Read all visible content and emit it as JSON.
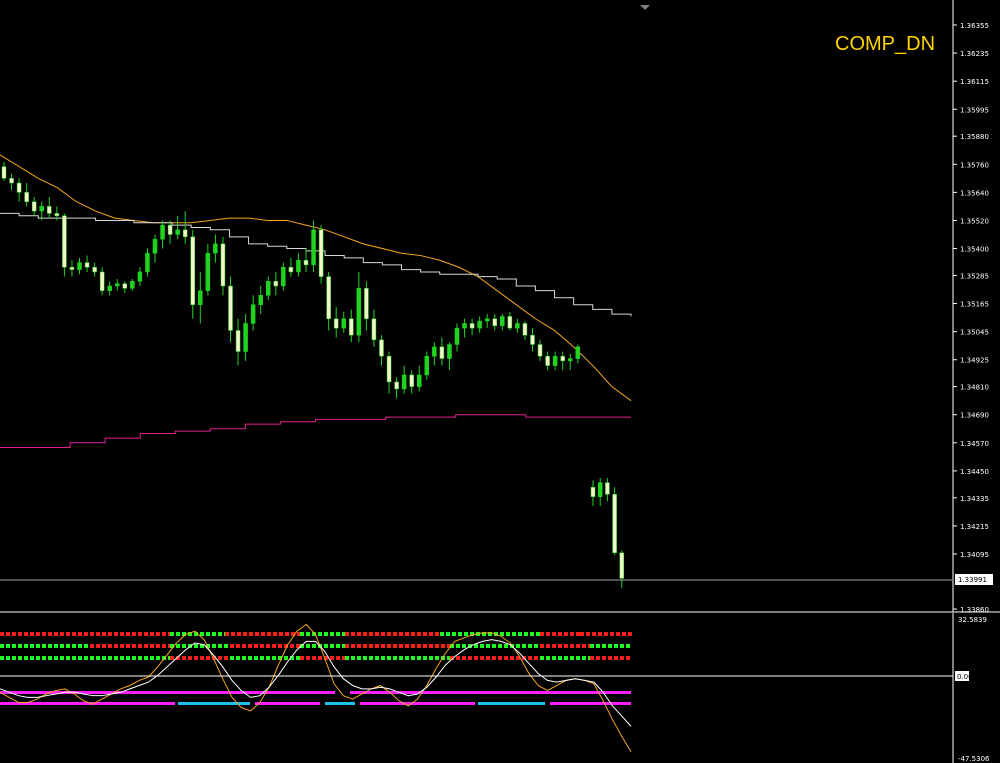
{
  "chart_title": "COMP_DN",
  "colors": {
    "background": "#000000",
    "bull": "#1FD41F",
    "bear": "#F4F7C8",
    "ma_orange": "#F5A623",
    "ma_white": "#D8D8D8",
    "band_magenta": "#E0208F",
    "grid_axis": "#FFFFFF",
    "dot_red": "#FF1E1E",
    "dot_green": "#1EFF1E",
    "bar_magenta": "#FF1EFF",
    "bar_cyan": "#1EC0F0",
    "title_yellow": "#FFD200"
  },
  "chart_data": [
    {
      "type": "candlestick",
      "title": "COMP_DN",
      "y_ticks": [
        "1.36355",
        "1.36235",
        "1.36115",
        "1.35995",
        "1.35880",
        "1.35760",
        "1.35640",
        "1.35520",
        "1.35400",
        "1.35285",
        "1.35165",
        "1.35045",
        "1.34925",
        "1.34810",
        "1.34690",
        "1.34570",
        "1.34450",
        "1.34335",
        "1.34215",
        "1.34095",
        "1.33860"
      ],
      "ylim": [
        1.3386,
        1.36355
      ],
      "current_price": "1.33991",
      "candles": [
        [
          1.3575,
          1.3577,
          1.3569,
          1.357
        ],
        [
          1.357,
          1.3572,
          1.3565,
          1.3568
        ],
        [
          1.3568,
          1.357,
          1.356,
          1.3564
        ],
        [
          1.3564,
          1.3568,
          1.3558,
          1.356
        ],
        [
          1.356,
          1.3562,
          1.3554,
          1.3556
        ],
        [
          1.3556,
          1.356,
          1.3552,
          1.3558
        ],
        [
          1.3558,
          1.3562,
          1.3553,
          1.3555
        ],
        [
          1.3555,
          1.3558,
          1.3552,
          1.3554
        ],
        [
          1.3554,
          1.3555,
          1.3528,
          1.3532
        ],
        [
          1.3532,
          1.3535,
          1.3528,
          1.3531
        ],
        [
          1.3531,
          1.3536,
          1.3529,
          1.3534
        ],
        [
          1.3534,
          1.3537,
          1.353,
          1.3532
        ],
        [
          1.3532,
          1.3534,
          1.3528,
          1.353
        ],
        [
          1.353,
          1.3532,
          1.352,
          1.3522
        ],
        [
          1.3522,
          1.3526,
          1.352,
          1.3524
        ],
        [
          1.3524,
          1.3527,
          1.3522,
          1.3525
        ],
        [
          1.3525,
          1.3526,
          1.3521,
          1.3523
        ],
        [
          1.3523,
          1.3527,
          1.3522,
          1.3526
        ],
        [
          1.3526,
          1.3532,
          1.3524,
          1.353
        ],
        [
          1.353,
          1.354,
          1.3528,
          1.3538
        ],
        [
          1.3538,
          1.3546,
          1.3534,
          1.3544
        ],
        [
          1.3544,
          1.3552,
          1.354,
          1.355
        ],
        [
          1.355,
          1.3552,
          1.3542,
          1.3546
        ],
        [
          1.3546,
          1.3554,
          1.3544,
          1.3548
        ],
        [
          1.3548,
          1.3556,
          1.3542,
          1.3545
        ],
        [
          1.3545,
          1.3548,
          1.351,
          1.3516
        ],
        [
          1.3516,
          1.353,
          1.3508,
          1.3522
        ],
        [
          1.3522,
          1.3542,
          1.352,
          1.3538
        ],
        [
          1.3538,
          1.3546,
          1.3534,
          1.3542
        ],
        [
          1.3542,
          1.3545,
          1.352,
          1.3524
        ],
        [
          1.3524,
          1.3528,
          1.35,
          1.3505
        ],
        [
          1.3505,
          1.351,
          1.349,
          1.3496
        ],
        [
          1.3496,
          1.3512,
          1.3492,
          1.3508
        ],
        [
          1.3508,
          1.352,
          1.3505,
          1.3516
        ],
        [
          1.3516,
          1.3524,
          1.3512,
          1.352
        ],
        [
          1.352,
          1.3528,
          1.3518,
          1.3526
        ],
        [
          1.3526,
          1.353,
          1.352,
          1.3524
        ],
        [
          1.3524,
          1.3534,
          1.3522,
          1.3532
        ],
        [
          1.3532,
          1.3536,
          1.3528,
          1.353
        ],
        [
          1.353,
          1.3538,
          1.3528,
          1.3535
        ],
        [
          1.3535,
          1.354,
          1.353,
          1.3533
        ],
        [
          1.3533,
          1.3552,
          1.353,
          1.3548
        ],
        [
          1.3548,
          1.355,
          1.3525,
          1.3528
        ],
        [
          1.3528,
          1.353,
          1.3505,
          1.351
        ],
        [
          1.351,
          1.3515,
          1.3502,
          1.3506
        ],
        [
          1.3506,
          1.3513,
          1.3504,
          1.351
        ],
        [
          1.351,
          1.3514,
          1.35,
          1.3503
        ],
        [
          1.3503,
          1.353,
          1.35,
          1.3523
        ],
        [
          1.3523,
          1.3526,
          1.3505,
          1.351
        ],
        [
          1.351,
          1.3514,
          1.3498,
          1.3501
        ],
        [
          1.3501,
          1.3503,
          1.349,
          1.3494
        ],
        [
          1.3494,
          1.3496,
          1.3478,
          1.3483
        ],
        [
          1.3483,
          1.3485,
          1.3476,
          1.348
        ],
        [
          1.348,
          1.349,
          1.3478,
          1.3486
        ],
        [
          1.3486,
          1.3488,
          1.3478,
          1.3481
        ],
        [
          1.3481,
          1.349,
          1.3479,
          1.3486
        ],
        [
          1.3486,
          1.3496,
          1.3484,
          1.3494
        ],
        [
          1.3494,
          1.35,
          1.349,
          1.3498
        ],
        [
          1.3498,
          1.3502,
          1.349,
          1.3493
        ],
        [
          1.3493,
          1.35,
          1.3488,
          1.3499
        ],
        [
          1.3499,
          1.3508,
          1.3496,
          1.3506
        ],
        [
          1.3506,
          1.351,
          1.3502,
          1.3508
        ],
        [
          1.3508,
          1.351,
          1.3503,
          1.3506
        ],
        [
          1.3506,
          1.3511,
          1.3504,
          1.3509
        ],
        [
          1.3509,
          1.3512,
          1.3506,
          1.351
        ],
        [
          1.351,
          1.3512,
          1.3505,
          1.3507
        ],
        [
          1.3507,
          1.3512,
          1.3505,
          1.3511
        ],
        [
          1.3511,
          1.3513,
          1.3505,
          1.3506
        ],
        [
          1.3506,
          1.351,
          1.3504,
          1.3508
        ],
        [
          1.3508,
          1.3509,
          1.3501,
          1.3503
        ],
        [
          1.3503,
          1.3506,
          1.3496,
          1.3499
        ],
        [
          1.3499,
          1.3501,
          1.3492,
          1.3494
        ],
        [
          1.3494,
          1.3496,
          1.3488,
          1.349
        ],
        [
          1.349,
          1.3496,
          1.3488,
          1.3494
        ],
        [
          1.3494,
          1.3496,
          1.3488,
          1.3492
        ],
        [
          1.3492,
          1.3495,
          1.3488,
          1.3493
        ],
        [
          1.3493,
          1.3499,
          1.3491,
          1.3498
        ],
        [
          1.3498,
          1.3499,
          1.3498,
          1.3498
        ],
        [
          1.3498,
          1.3499,
          1.3498,
          1.3498
        ],
        [
          1.3498,
          1.3499,
          1.3498,
          1.3498
        ],
        [
          1.3498,
          1.3499,
          1.3498,
          1.3498
        ],
        [
          1.3498,
          1.3499,
          1.3498,
          1.3498
        ],
        [
          1.3498,
          1.3499,
          1.3498,
          1.3498
        ],
        [
          1.3498,
          1.3499,
          1.3498,
          1.3498
        ],
        [
          1.3498,
          1.3499,
          1.3498,
          1.3498
        ],
        [
          1.3498,
          1.3499,
          1.3498,
          1.3498
        ],
        [
          1.3498,
          1.3499,
          1.3498,
          1.3498
        ],
        [
          1.3399,
          1.3442,
          1.3399,
          1.3438
        ],
        [
          1.3438,
          1.3441,
          1.343,
          1.3434
        ],
        [
          1.3434,
          1.3442,
          1.343,
          1.344
        ],
        [
          1.344,
          1.3442,
          1.3432,
          1.3435
        ],
        [
          1.3435,
          1.3438,
          1.3409,
          1.341
        ],
        [
          1.341,
          1.3411,
          1.3395,
          1.33991
        ]
      ],
      "series": [
        {
          "values": [
            1.358,
            1.3575,
            1.357,
            1.3566,
            1.356,
            1.3556,
            1.3553,
            1.3552,
            1.3551,
            1.3551,
            1.3551,
            1.3552,
            1.3553,
            1.3553,
            1.3552,
            1.3552,
            1.355,
            1.3548,
            1.3545,
            1.3542,
            1.354,
            1.3538,
            1.3537,
            1.3535,
            1.3532,
            1.3528,
            1.3522,
            1.3516,
            1.351,
            1.3505,
            1.3498,
            1.349,
            1.3481,
            1.3475
          ]
        },
        {
          "values": [
            1.3555,
            1.3554,
            1.3553,
            1.3553,
            1.3553,
            1.3552,
            1.3552,
            1.3551,
            1.3551,
            1.355,
            1.3549,
            1.3548,
            1.3545,
            1.3542,
            1.3541,
            1.354,
            1.3539,
            1.3537,
            1.3536,
            1.3534,
            1.3533,
            1.3531,
            1.353,
            1.3529,
            1.3529,
            1.3528,
            1.3527,
            1.3524,
            1.3522,
            1.3519,
            1.3516,
            1.3514,
            1.3512,
            1.3511
          ]
        },
        {
          "values": [
            1.3455,
            1.3455,
            1.3457,
            1.3459,
            1.3461,
            1.3462,
            1.3463,
            1.3465,
            1.3466,
            1.3467,
            1.3467,
            1.3468,
            1.3468,
            1.3469,
            1.3469,
            1.3468,
            1.3468,
            1.3468,
            1.3468
          ]
        }
      ]
    },
    {
      "type": "line",
      "y_ticks": [
        "32.5839",
        "0.00",
        "-47.5306"
      ],
      "ylim": [
        -47.5306,
        32.5839
      ],
      "zero_label": "0.00",
      "series": [
        {
          "values": [
            -10,
            -13,
            -16,
            -16,
            -14,
            -11,
            -9,
            -8,
            -11,
            -15,
            -17,
            -14,
            -11,
            -8,
            -6,
            -3,
            -1,
            5,
            12,
            19,
            24,
            26,
            21,
            10,
            -2,
            -13,
            -19,
            -21,
            -16,
            -7,
            6,
            18,
            26,
            30,
            24,
            10,
            -5,
            -12,
            -14,
            -11,
            -8,
            -6,
            -10,
            -15,
            -18,
            -14,
            -6,
            4,
            13,
            20,
            22,
            24,
            25,
            25,
            23,
            19,
            11,
            1,
            -6,
            -9,
            -6,
            -3,
            -2,
            -3,
            -5,
            -15,
            -26,
            -36,
            -45
          ]
        },
        {
          "values": [
            -8,
            -10,
            -12,
            -13,
            -13,
            -12,
            -11,
            -10,
            -10,
            -11,
            -12,
            -12,
            -11,
            -10,
            -8,
            -6,
            -4,
            0,
            5,
            10,
            15,
            19,
            18,
            12,
            5,
            -3,
            -9,
            -13,
            -12,
            -7,
            0,
            8,
            15,
            20,
            20,
            14,
            5,
            -2,
            -6,
            -8,
            -8,
            -7,
            -8,
            -10,
            -12,
            -11,
            -7,
            -1,
            6,
            11,
            15,
            18,
            20,
            21,
            20,
            18,
            13,
            7,
            1,
            -3,
            -4,
            -3,
            -2,
            -3,
            -4,
            -10,
            -18,
            -24,
            -30
          ]
        }
      ]
    }
  ]
}
